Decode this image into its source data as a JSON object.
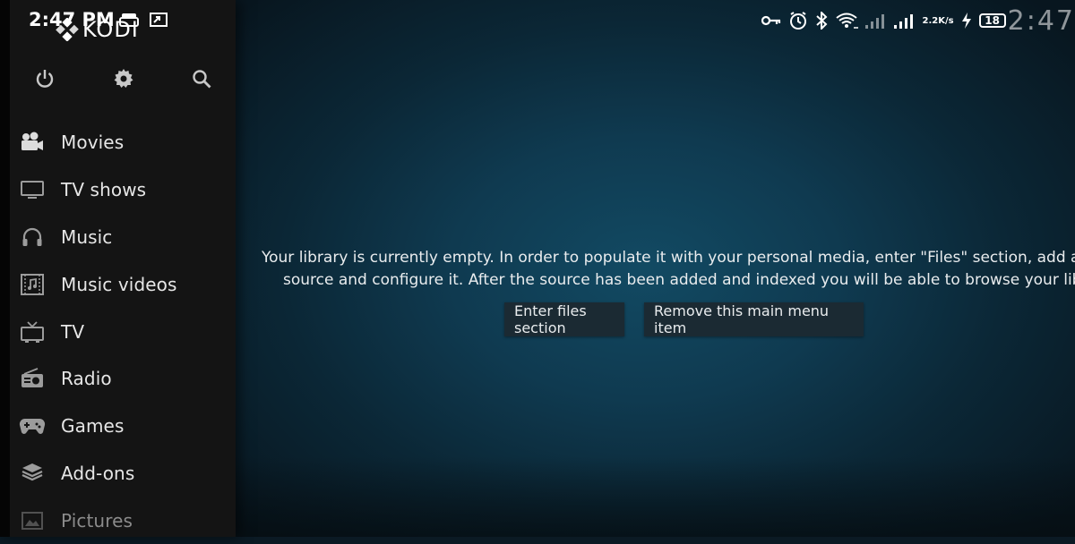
{
  "status_bar": {
    "time": "2:47 PM",
    "speed_value": "2.2",
    "speed_unit": "K/s",
    "battery": "18",
    "ghost_clock": "2:47"
  },
  "app": {
    "name": "KODI"
  },
  "sidebar": {
    "top_icons": [
      "power-icon",
      "gear-icon",
      "search-icon"
    ],
    "items": [
      {
        "label": "Movies",
        "icon": "movie-camera-icon"
      },
      {
        "label": "TV shows",
        "icon": "tv-monitor-icon"
      },
      {
        "label": "Music",
        "icon": "headphones-icon"
      },
      {
        "label": "Music videos",
        "icon": "music-video-icon"
      },
      {
        "label": "TV",
        "icon": "tv-antenna-icon"
      },
      {
        "label": "Radio",
        "icon": "radio-icon"
      },
      {
        "label": "Games",
        "icon": "gamepad-icon"
      },
      {
        "label": "Add-ons",
        "icon": "addons-box-icon"
      },
      {
        "label": "Pictures",
        "icon": "pictures-icon"
      }
    ]
  },
  "main": {
    "message_line1": "Your library is currently empty. In order to populate it with your personal media, enter \"Files\" section, add a",
    "message_line2": "source and configure it. After the source has been added and indexed you will be able to browse your libr",
    "buttons": {
      "enter_files": "Enter files section",
      "remove_item": "Remove this main menu item"
    }
  },
  "colors": {
    "sidebar_bg": "#141414",
    "background_center": "#124a63",
    "button_bg": "#1b2a33",
    "text": "#e6e6e6"
  }
}
